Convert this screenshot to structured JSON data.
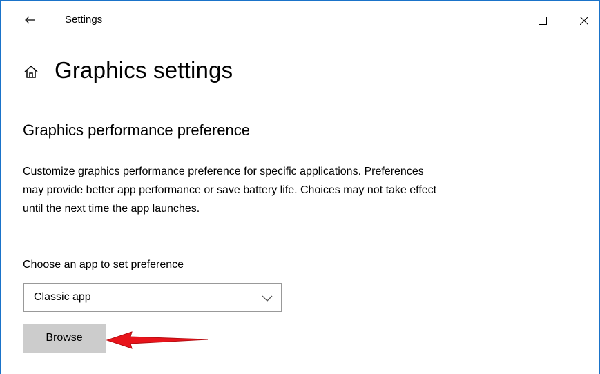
{
  "window": {
    "app_title": "Settings",
    "accent_color": "#1a73c9"
  },
  "titlebar": {
    "back_icon": "arrow-left-icon",
    "minimize_icon": "minimize-icon",
    "maximize_icon": "maximize-icon",
    "close_icon": "close-icon"
  },
  "page": {
    "home_icon": "home-icon",
    "title": "Graphics settings",
    "section_title": "Graphics performance preference",
    "description": "Customize graphics performance preference for specific applications. Preferences may provide better app performance or save battery life. Choices may not take effect until the next time the app launches.",
    "choose_label": "Choose an app to set preference",
    "dropdown": {
      "selected": "Classic app",
      "icon": "chevron-down-icon"
    },
    "browse_label": "Browse"
  },
  "annotation": {
    "type": "red-arrow",
    "color": "#e8141b"
  }
}
